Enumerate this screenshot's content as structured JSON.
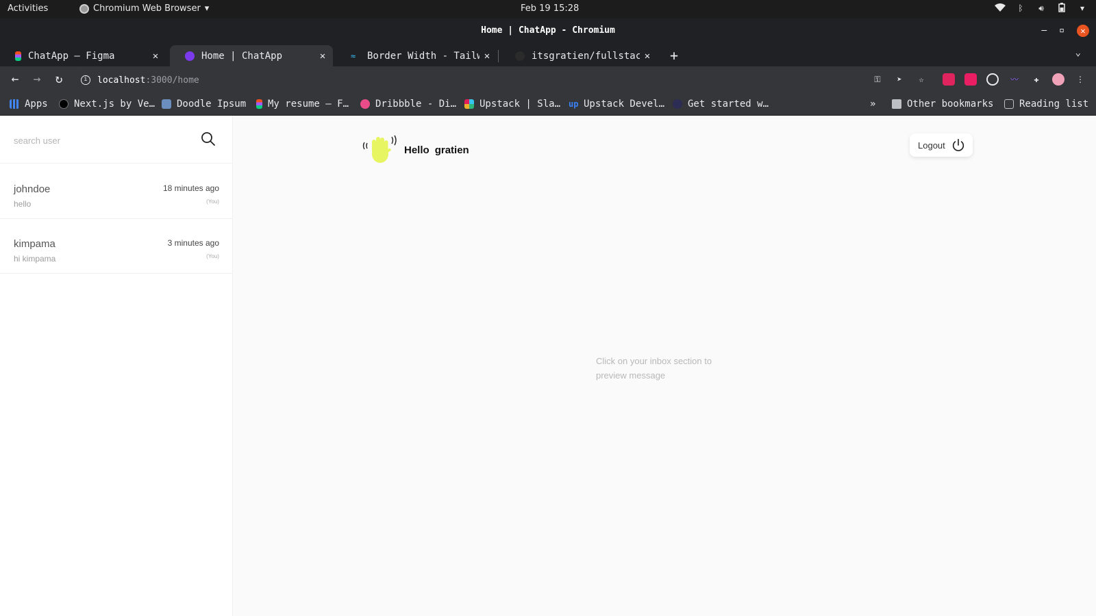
{
  "system_bar": {
    "activities": "Activities",
    "app_name": "Chromium Web Browser",
    "clock": "Feb 19  15:28"
  },
  "window": {
    "title": "Home | ChatApp - Chromium"
  },
  "tabs": [
    {
      "title": "ChatApp – Figma",
      "favicon_color": "#a259ff"
    },
    {
      "title": "Home | ChatApp",
      "favicon_color": "#7c3aed"
    },
    {
      "title": "Border Width - Tailwind",
      "favicon_color": "#38bdf8"
    },
    {
      "title": "itsgratien/fullstack-c",
      "favicon_color": "#2b2b2b"
    }
  ],
  "address_bar": {
    "host": "localhost",
    "path": ":3000/home"
  },
  "bookmarks": {
    "items": [
      {
        "label": "Apps",
        "color": "#4285f4"
      },
      {
        "label": "Next.js by Ve…",
        "color": "#000000"
      },
      {
        "label": "Doodle Ipsum",
        "color": "#6c8ebf"
      },
      {
        "label": "My resume – F…",
        "color": "#f24e1e"
      },
      {
        "label": "Dribbble - Di…",
        "color": "#ea4c89"
      },
      {
        "label": "Upstack | Sla…",
        "color": "#36c5f0"
      },
      {
        "label": "Upstack Devel…",
        "color": "#3b82f6"
      },
      {
        "label": "Get started w…",
        "color": "#2c2c54"
      }
    ],
    "overflow": "»",
    "other": "Other bookmarks",
    "reading_list": "Reading list"
  },
  "sidebar": {
    "search_placeholder": "search user",
    "conversations": [
      {
        "name": "johndoe",
        "time": "18 minutes ago",
        "last_message": "hello",
        "sender_tag": "(You)"
      },
      {
        "name": "kimpama",
        "time": "3 minutes ago",
        "last_message": "hi kimpama",
        "sender_tag": "(You)"
      }
    ]
  },
  "header": {
    "greeting": "Hello",
    "username": "gratien",
    "logout_label": "Logout"
  },
  "main": {
    "empty_hint": "Click on your inbox section to preview message"
  },
  "colors": {
    "wave_hand": "#e8f562",
    "accent_close": "#e95420"
  }
}
